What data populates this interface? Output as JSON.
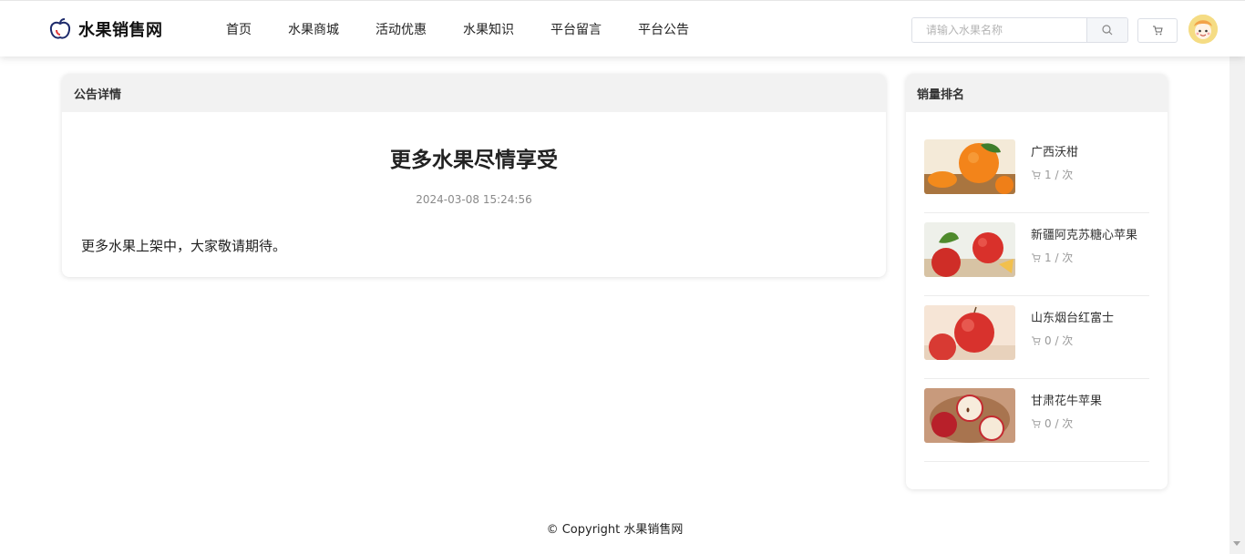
{
  "header": {
    "logo_text": "水果销售网",
    "nav": [
      "首页",
      "水果商城",
      "活动优惠",
      "水果知识",
      "平台留言",
      "平台公告"
    ],
    "search_placeholder": "请输入水果名称"
  },
  "notice": {
    "panel_title": "公告详情",
    "title": "更多水果尽情享受",
    "date": "2024-03-08 15:24:56",
    "content": "更多水果上架中，大家敬请期待。"
  },
  "ranking": {
    "panel_title": "销量排名",
    "items": [
      {
        "name": "广西沃柑",
        "count": "1 / 次"
      },
      {
        "name": "新疆阿克苏糖心苹果",
        "count": "1 / 次"
      },
      {
        "name": "山东烟台红富士",
        "count": "0 / 次"
      },
      {
        "name": "甘肃花牛苹果",
        "count": "0 / 次"
      }
    ]
  },
  "footer": {
    "copyright": "© Copyright 水果销售网"
  },
  "colors": {
    "brand": "#1d2a6b",
    "accent_apple": "#e23b3b",
    "accent_orange": "#f08a17"
  }
}
